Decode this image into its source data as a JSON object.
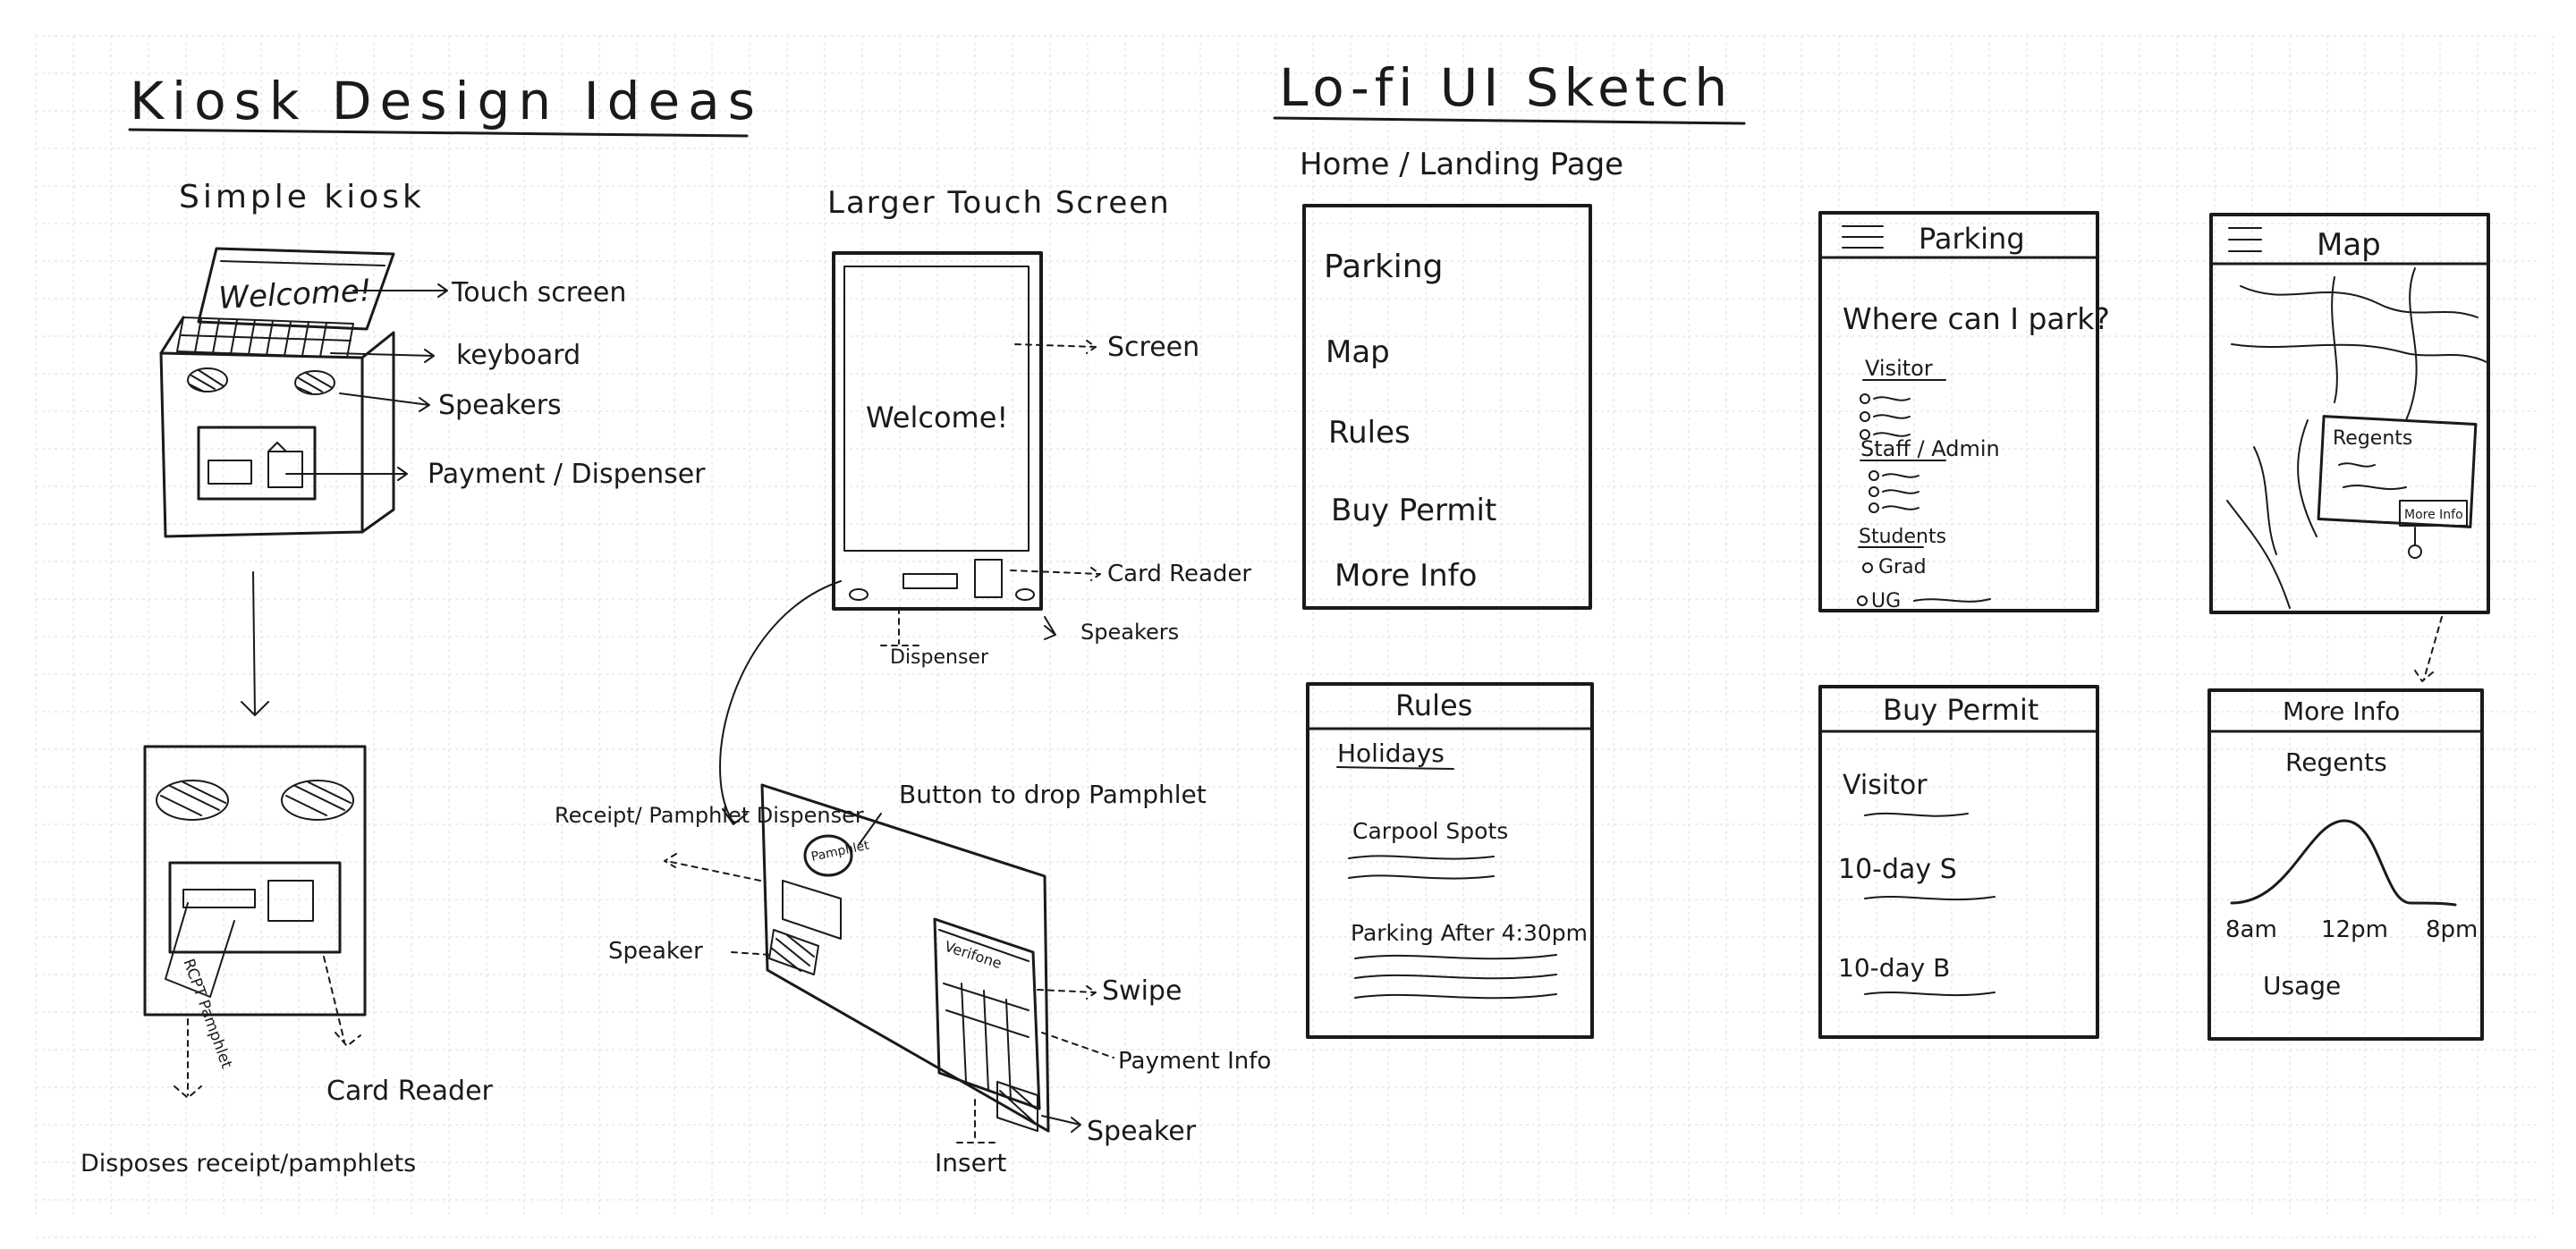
{
  "left_page": {
    "title": "Kiosk Design Ideas",
    "simple_kiosk": {
      "heading": "Simple kiosk",
      "screen_text": "Welcome!",
      "labels": [
        "Touch screen",
        "keyboard",
        "Speakers",
        "Payment / Dispenser"
      ],
      "bottom_labels": [
        "Disposes receipt/pamphlets",
        "Card Reader"
      ],
      "receipt_text": "RCPT Pamphlet"
    },
    "larger_touch_screen": {
      "heading": "Larger Touch Screen",
      "screen_text": "Welcome!",
      "labels": [
        "Screen",
        "Card Reader",
        "Speakers",
        "Dispenser"
      ]
    },
    "angled_kiosk": {
      "labels": [
        "Receipt/ Pamphlet Dispenser",
        "Button to drop Pamphlet",
        "Speaker",
        "Swipe",
        "Payment Info",
        "Speaker",
        "Insert"
      ],
      "button_text": "Pamphlet",
      "reader_text": "Verifone"
    }
  },
  "right_page": {
    "title": "Lo-fi UI Sketch",
    "subtitle": "Home / Landing Page",
    "home_menu": [
      "Parking",
      "Map",
      "Rules",
      "Buy Permit",
      "More Info"
    ],
    "parking_screen": {
      "title": "Parking",
      "question": "Where can I park?",
      "groups": [
        "Visitor",
        "Staff / Admin",
        "Students"
      ],
      "items": [
        "Grad",
        "UG"
      ]
    },
    "map_screen": {
      "title": "Map",
      "popup_title": "Regents",
      "popup_button": "More Info"
    },
    "rules_screen": {
      "title": "Rules",
      "heading": "Holidays",
      "items": [
        "Carpool Spots",
        "Parking After 4:30pm"
      ]
    },
    "buy_permit_screen": {
      "title": "Buy Permit",
      "items": [
        "Visitor",
        "10-day S",
        "10-day B"
      ]
    },
    "more_info_screen": {
      "title": "More Info",
      "subtitle": "Regents",
      "x_ticks": [
        "8am",
        "12pm",
        "8pm"
      ],
      "xlabel": "Usage"
    }
  }
}
